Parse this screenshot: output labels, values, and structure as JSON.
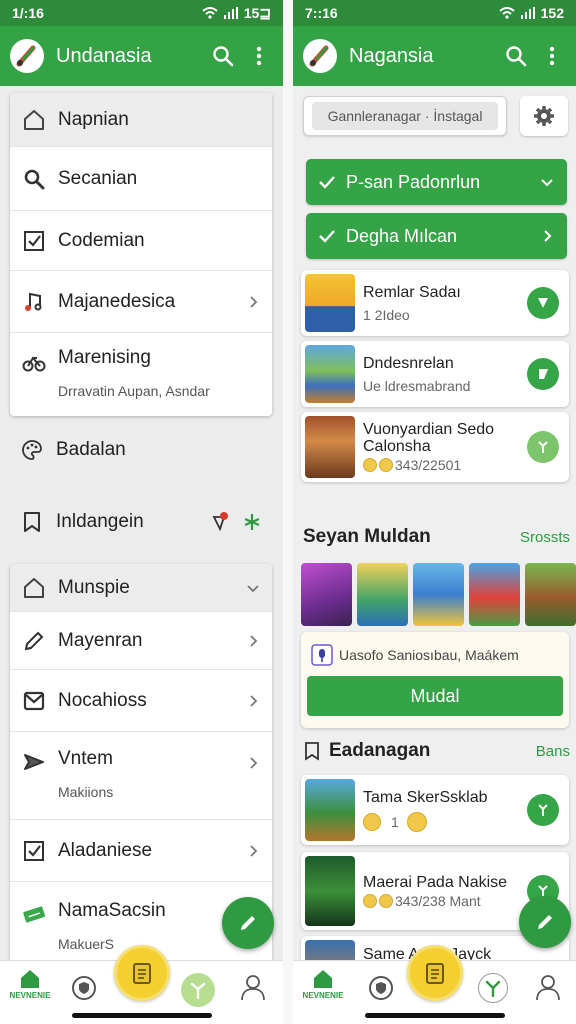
{
  "left": {
    "status": {
      "time": "1/:16",
      "battery": "15⊒"
    },
    "appbar": {
      "title": "Undanasia"
    },
    "menu_card_1": [
      {
        "label": "Napnian",
        "icon": "home-icon"
      },
      {
        "label": "Secanian",
        "icon": "search-icon"
      },
      {
        "label": "Codemian",
        "icon": "checkbox-icon"
      },
      {
        "label": "Majanedesica",
        "icon": "music-note-icon"
      },
      {
        "label": "Marenising",
        "sub": "Drravatin Aupan, Asndar",
        "icon": "bicycle-icon"
      }
    ],
    "floating_rows": [
      {
        "label": "Badalan",
        "icon": "palette-icon"
      },
      {
        "label": "Inldangein",
        "icon": "bookmark-icon"
      }
    ],
    "menu_card_2": {
      "header": "Munspie",
      "items": [
        {
          "label": "Mayenran",
          "icon": "pencil-icon"
        },
        {
          "label": "Nocahioss",
          "icon": "envelope-icon"
        },
        {
          "label": "Vntem",
          "sub": "Makiions",
          "icon": "send-icon"
        },
        {
          "label": "Aladaniese",
          "icon": "checkbox-icon"
        },
        {
          "label": "NamaSacsin",
          "sub": "MakuerS",
          "icon": "cash-icon"
        }
      ]
    },
    "nav": {
      "home_label": "NEVNENIE"
    }
  },
  "right": {
    "status": {
      "time": "7::16",
      "battery": "152"
    },
    "appbar": {
      "title": "Nagansia"
    },
    "search": {
      "value": "Gannleranagar · İnstagal"
    },
    "green_buttons": [
      {
        "label": "P-san Padonrlun"
      },
      {
        "label": "Degha Mılcan"
      }
    ],
    "game_cards": [
      {
        "title": "Remlar Sadaı",
        "sub": "1 2Ideo"
      },
      {
        "title": "Dndesnrelan",
        "sub": "Ue ldresmabrand"
      },
      {
        "title": "Vuonyardian Sedo Calonsha",
        "sub": "343/22501"
      }
    ],
    "section1": {
      "title": "Seyan Muldan",
      "link": "Srossts"
    },
    "promo": {
      "text": "Uasofo Saniosıbau, Maákem",
      "button": "Mudal"
    },
    "section2": {
      "title": "Eadanagan",
      "link": "Bans"
    },
    "list_cards": [
      {
        "title": "Tama SkerSsklab",
        "sub": "1"
      },
      {
        "title": "Maerai Pada Nakise",
        "sub": "343/238 Mant"
      },
      {
        "title": "Same Anoa Jayck",
        "sub": ""
      }
    ],
    "nav": {
      "home_label": "NEVNENIE"
    }
  },
  "colors": {
    "primary": "#34a346",
    "accent": "#f3cf2f"
  }
}
